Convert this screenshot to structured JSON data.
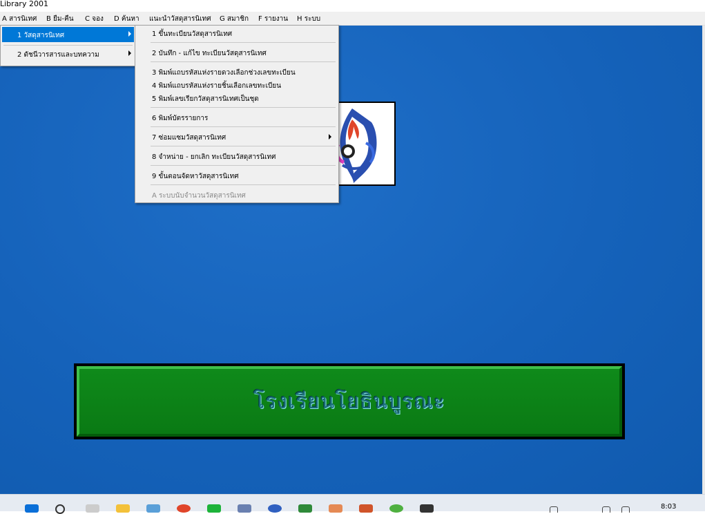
{
  "window": {
    "title": "Library 2001"
  },
  "menubar": [
    {
      "label": "A สารนิเทศ"
    },
    {
      "label": "B ยืม-คืน"
    },
    {
      "label": "C จอง"
    },
    {
      "label": "D ค้นหา"
    },
    {
      "label": "แนะนำวัสดุสารนิเทศ"
    },
    {
      "label": "G สมาชิก"
    },
    {
      "label": "F รายงาน"
    },
    {
      "label": "H ระบบ"
    }
  ],
  "menu_level1": [
    {
      "label": "1  วัสดุสารนิเทศ",
      "selected": true,
      "submenu": true
    },
    {
      "label": "2  ดัชนีวารสารและบทความ",
      "selected": false,
      "submenu": true
    }
  ],
  "menu_level2": [
    {
      "label": "1  ขึ้นทะเบียนวัสดุสารนิเทศ"
    },
    {
      "label": "2  บันทึก - แก้ไข  ทะเบียนวัสดุสารนิเทศ"
    },
    {
      "label": "3  พิมพ์แถบรหัสแห่งรายดวงเลือกช่วงเลขทะเบียน"
    },
    {
      "label": "4  พิมพ์แถบรหัสแห่งรายชิ้นเลือกเลขทะเบียน"
    },
    {
      "label": "5  พิมพ์เลขเรียกวัสดุสารนิเทศเป็นชุด"
    },
    {
      "label": "6 พิมพ์บัตรรายการ"
    },
    {
      "label": "7 ซ่อมแซมวัสดุสารนิเทศ",
      "submenu": true
    },
    {
      "label": "8 จำหน่าย - ยกเลิก ทะเบียนวัสดุสารนิเทศ"
    },
    {
      "label": "9 ขั้นตอนจัดหาวัสดุสารนิเทศ"
    },
    {
      "label": "A ระบบนับจำนวนวัสดุสารนิเทศ",
      "disabled": true
    }
  ],
  "banner": {
    "text": "โรงเรียนโยธินบูรณะ"
  },
  "taskbar": {
    "clock": "8:03"
  },
  "colors": {
    "desktop": "#1562ba",
    "banner": "#0a7a14",
    "menu_highlight": "#0078d7"
  }
}
